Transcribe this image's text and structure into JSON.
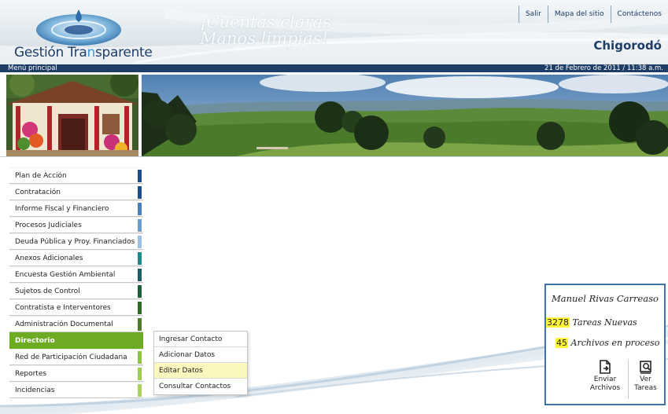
{
  "header": {
    "logo_text_part1": "Gestión Tra",
    "logo_text_highlight": "n",
    "logo_text_part2": "sparente",
    "slogan_line1": "¡Cuentas claras,",
    "slogan_line2": "Manos limpias!",
    "top_links": [
      "Salir",
      "Mapa del sitio",
      "Contáctenos"
    ],
    "municipality": "Chigorodó"
  },
  "navbar": {
    "menu_label": "Menú principal",
    "datetime": "21 de Febrero de 2011 / 11:38 a.m."
  },
  "menu": {
    "items": [
      {
        "label": "Plan de Acción",
        "color": "#1e4d8c"
      },
      {
        "label": "Contratación",
        "color": "#1e4d8c"
      },
      {
        "label": "Informe Fiscal y Financiero",
        "color": "#4a7fc1"
      },
      {
        "label": "Procesos Judiciales",
        "color": "#6b9bd1"
      },
      {
        "label": "Deuda Pública y Proy. Financiados",
        "color": "#9dbfe3"
      },
      {
        "label": "Anexos Adicionales",
        "color": "#1b8a8a"
      },
      {
        "label": "Encuesta Gestión Ambiental",
        "color": "#1c5e68"
      },
      {
        "label": "Sujetos de Control",
        "color": "#1e5e3a"
      },
      {
        "label": "Contratista e Interventores",
        "color": "#2f6b22"
      },
      {
        "label": "Administración Documental",
        "color": "#4d7d2c"
      },
      {
        "label": "Directorio",
        "color": "#6dab23"
      },
      {
        "label": "Red de Participación Ciudadana",
        "color": "#8cc63f"
      },
      {
        "label": "Reportes",
        "color": "#9ccc4a"
      },
      {
        "label": "Incidencias",
        "color": "#a9d35a"
      }
    ],
    "active_index": 10
  },
  "submenu": {
    "items": [
      "Ingresar Contacto",
      "Adicionar Datos",
      "Editar Datos",
      "Consultar Contactos"
    ],
    "hover_index": 2
  },
  "user_panel": {
    "name": "Manuel Rivas Carreaso",
    "tasks_count": "3278",
    "tasks_label": "Tareas Nuevas",
    "files_count": "45",
    "files_label": "Archivos en proceso",
    "send_label_1": "Enviar",
    "send_label_2": "Archivos",
    "view_label_1": "Ver",
    "view_label_2": "Tareas"
  },
  "colors": {
    "navy": "#1e3d67",
    "active_green": "#6dab23",
    "highlight_yellow": "#fff43a",
    "panel_border": "#3f73a6"
  }
}
